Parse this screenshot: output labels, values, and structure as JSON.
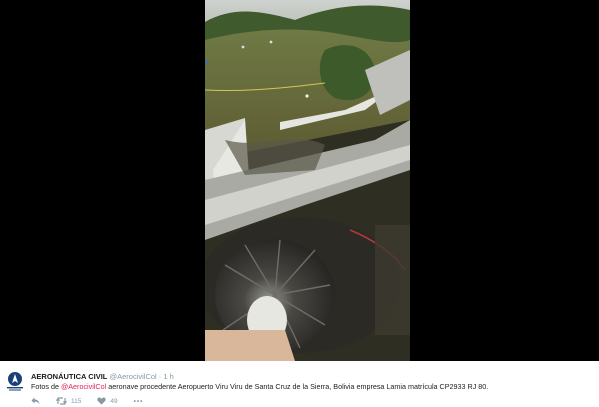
{
  "colors": {
    "letterbox": "#000000",
    "mention": "#e0245e",
    "muted": "#8899a6",
    "text": "#222222"
  },
  "media": {
    "photo_icon": "crash-wreckage-photo"
  },
  "tweet": {
    "display_name": "AERONÁUTICA CIVIL",
    "handle": "@AerocivilCol",
    "separator": "·",
    "time": "1 h",
    "text_before": "Fotos de ",
    "mention": "@AerocivilCol",
    "text_after": " aeronave procedente Aeropuerto Viru Viru de Santa Cruz de la Sierra, Bolivia empresa Lamia matrícula CP2933 RJ 80.",
    "actions": {
      "reply_icon": "reply-icon",
      "retweet_icon": "retweet-icon",
      "retweet_count": "115",
      "like_icon": "heart-icon",
      "like_count": "49",
      "more_icon": "more-icon",
      "more_label": "•••"
    }
  }
}
